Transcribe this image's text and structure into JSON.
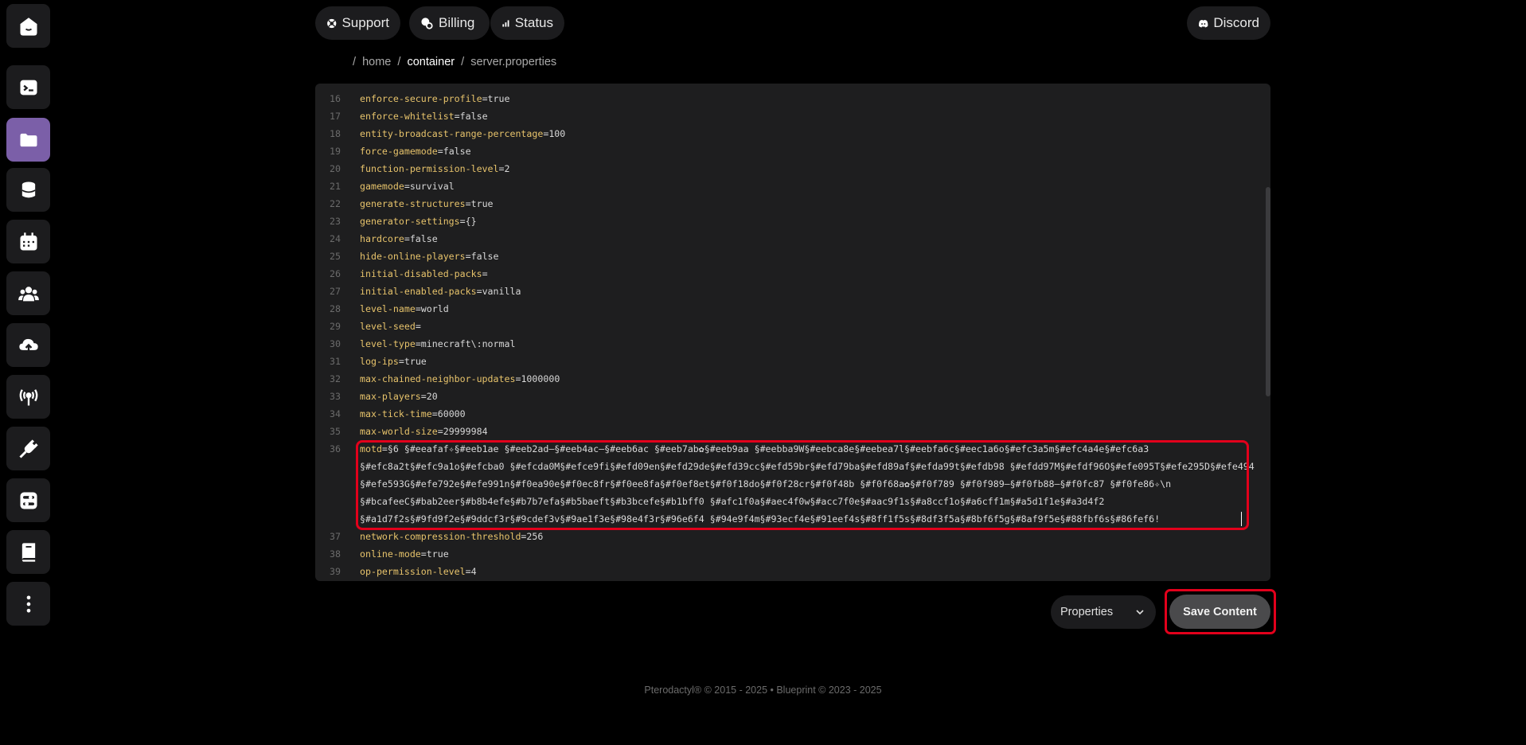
{
  "sidebar": {
    "items": [
      {
        "icon": "home-logo-icon"
      },
      {
        "icon": "terminal-icon"
      },
      {
        "icon": "folder-icon",
        "active": true
      },
      {
        "icon": "database-icon"
      },
      {
        "icon": "calendar-icon"
      },
      {
        "icon": "users-icon"
      },
      {
        "icon": "cloud-upload-icon"
      },
      {
        "icon": "broadcast-icon"
      },
      {
        "icon": "plug-icon"
      },
      {
        "icon": "toggle-settings-icon"
      },
      {
        "icon": "book-icon"
      },
      {
        "icon": "more-vertical-icon"
      }
    ]
  },
  "topnav": {
    "support": "Support",
    "billing": "Billing",
    "status": "Status",
    "discord": "Discord"
  },
  "breadcrumb": {
    "sep": "/",
    "home": "home",
    "container": "container",
    "file": "server.properties"
  },
  "editor": {
    "lines": [
      {
        "n": "16",
        "k": "enforce-secure-profile",
        "v": "true"
      },
      {
        "n": "17",
        "k": "enforce-whitelist",
        "v": "false"
      },
      {
        "n": "18",
        "k": "entity-broadcast-range-percentage",
        "v": "100"
      },
      {
        "n": "19",
        "k": "force-gamemode",
        "v": "false"
      },
      {
        "n": "20",
        "k": "function-permission-level",
        "v": "2"
      },
      {
        "n": "21",
        "k": "gamemode",
        "v": "survival"
      },
      {
        "n": "22",
        "k": "generate-structures",
        "v": "true"
      },
      {
        "n": "23",
        "k": "generator-settings",
        "v": "{}"
      },
      {
        "n": "24",
        "k": "hardcore",
        "v": "false"
      },
      {
        "n": "25",
        "k": "hide-online-players",
        "v": "false"
      },
      {
        "n": "26",
        "k": "initial-disabled-packs",
        "v": ""
      },
      {
        "n": "27",
        "k": "initial-enabled-packs",
        "v": "vanilla"
      },
      {
        "n": "28",
        "k": "level-name",
        "v": "world"
      },
      {
        "n": "29",
        "k": "level-seed",
        "v": ""
      },
      {
        "n": "30",
        "k": "level-type",
        "v": "minecraft\\:normal"
      },
      {
        "n": "31",
        "k": "log-ips",
        "v": "true"
      },
      {
        "n": "32",
        "k": "max-chained-neighbor-updates",
        "v": "1000000"
      },
      {
        "n": "33",
        "k": "max-players",
        "v": "20"
      },
      {
        "n": "34",
        "k": "max-tick-time",
        "v": "60000"
      },
      {
        "n": "35",
        "k": "max-world-size",
        "v": "29999984"
      }
    ],
    "motd_number": "36",
    "motd_key": "motd",
    "motd_lines": [
      "§6 §#eeafaf✧§#eeb1ae §#eeb2ad—§#eeb4ac—§#eeb6ac §#eeb7ab✿§#eeb9aa §#eebba9W§#eebca8e§#eebea7l§#eebfa6c§#eec1a6o§#efc3a5m§#efc4a4e§#efc6a3",
      "§#efc8a2t§#efc9a1o§#efcba0 §#efcda0M§#efce9fi§#efd09en§#efd29de§#efd39cc§#efd59br§#efd79ba§#efd89af§#efda99t§#efdb98 §#efdd97M§#efdf96O§#efe095T§#efe295D§#efe494",
      "§#efe593G§#efe792e§#efe991n§#f0ea90e§#f0ec8fr§#f0ee8fa§#f0ef8et§#f0f18do§#f0f28cr§#f0f48b §#f0f68a✿§#f0f789 §#f0f989—§#f0fb88—§#f0fc87 §#f0fe86✧\\n",
      "§#bcafeeC§#bab2eer§#b8b4efe§#b7b7efa§#b5baeft§#b3bcefe§#b1bff0 §#afc1f0a§#aec4f0w§#acc7f0e§#aac9f1s§#a8ccf1o§#a6cff1m§#a5d1f1e§#a3d4f2",
      "§#a1d7f2s§#9fd9f2e§#9ddcf3r§#9cdef3v§#9ae1f3e§#98e4f3r§#96e6f4 §#94e9f4m§#93ecf4e§#91eef4s§#8ff1f5s§#8df3f5a§#8bf6f5g§#8af9f5e§#88fbf6s§#86fef6!"
    ],
    "after": [
      {
        "n": "37",
        "k": "network-compression-threshold",
        "v": "256"
      },
      {
        "n": "38",
        "k": "online-mode",
        "v": "true"
      },
      {
        "n": "39",
        "k": "op-permission-level",
        "v": "4"
      }
    ]
  },
  "controls": {
    "mode_select": "Properties",
    "save": "Save Content"
  },
  "footer": "Pterodactyl® © 2015 - 2025  •  Blueprint © 2023 - 2025"
}
